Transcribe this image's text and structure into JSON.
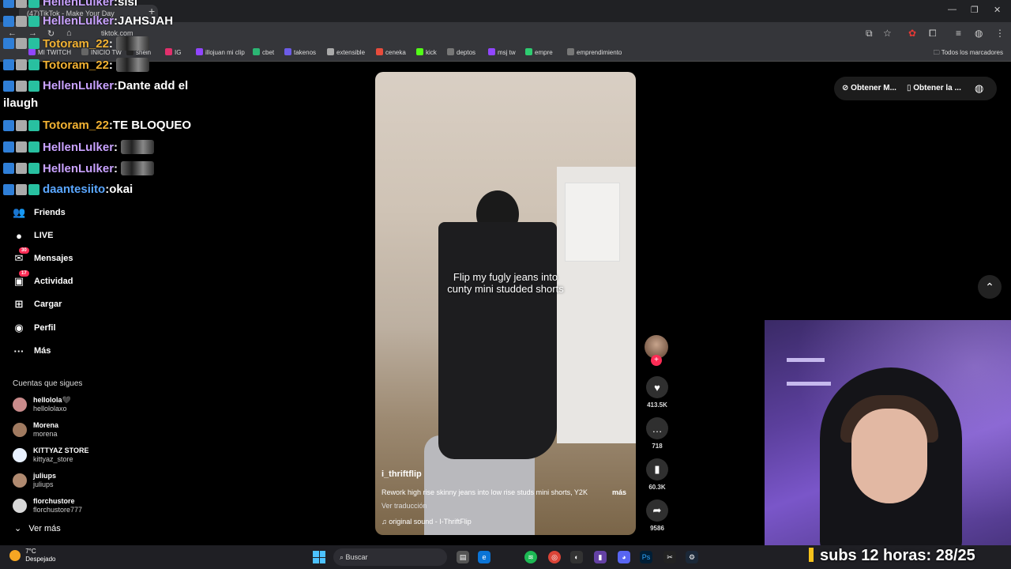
{
  "browser": {
    "tab_title": "(47)TikTok - Make Your Day",
    "url": "tiktok.com",
    "bookmarks": [
      {
        "label": "MI TWITCH",
        "color": "#9146ff"
      },
      {
        "label": "INICIO TW",
        "color": "#666666"
      },
      {
        "label": "shein",
        "color": "#222222"
      },
      {
        "label": "IG",
        "color": "#e1306c"
      },
      {
        "label": "illojuan mi clip",
        "color": "#9146ff"
      },
      {
        "label": "cbet",
        "color": "#2bb673"
      },
      {
        "label": "takenos",
        "color": "#6c5ce7"
      },
      {
        "label": "extensible",
        "color": "#aaaaaa"
      },
      {
        "label": "ceneka",
        "color": "#e74c3c"
      },
      {
        "label": "kick",
        "color": "#53fc18"
      },
      {
        "label": "deptos",
        "color": "#777777"
      },
      {
        "label": "msj tw",
        "color": "#9146ff"
      },
      {
        "label": "empre",
        "color": "#2ecc71"
      },
      {
        "label": "emprendimiento",
        "color": "#777777"
      }
    ],
    "all_bookmarks": "Todos los marcadores"
  },
  "chat": [
    {
      "user": "HellenLulker",
      "msg": "sisi",
      "color": "#c9a2ff",
      "emote": false
    },
    {
      "user": "HellenLulker",
      "msg": "JAHSJAH",
      "color": "#c9a2ff",
      "emote": false
    },
    {
      "user": "Totoram_22",
      "msg": "",
      "color": "#f2b233",
      "emote": true
    },
    {
      "user": "Totoram_22",
      "msg": "",
      "color": "#f2b233",
      "emote": true
    },
    {
      "user": "HellenLulker",
      "msg": "Dante add el",
      "color": "#c9a2ff",
      "emote": false
    },
    {
      "user": "",
      "msg": "ilaugh",
      "color": "#ffffff",
      "emote": false
    },
    {
      "user": "Totoram_22",
      "msg": "TE BLOQUEO",
      "color": "#f2b233",
      "emote": false
    },
    {
      "user": "HellenLulker",
      "msg": "",
      "color": "#c9a2ff",
      "emote": true
    },
    {
      "user": "HellenLulker",
      "msg": "",
      "color": "#c9a2ff",
      "emote": true
    },
    {
      "user": "daantesiito",
      "msg": "okai",
      "color": "#5aa7ff",
      "emote": false
    }
  ],
  "sidebar": {
    "nav": [
      {
        "label": "Friends",
        "icon": "friends-icon",
        "glyph": "👥",
        "badge": ""
      },
      {
        "label": "LIVE",
        "icon": "live-icon",
        "glyph": "●",
        "badge": ""
      },
      {
        "label": "Mensajes",
        "icon": "messages-icon",
        "glyph": "✉",
        "badge": "30"
      },
      {
        "label": "Actividad",
        "icon": "activity-icon",
        "glyph": "▣",
        "badge": "17"
      },
      {
        "label": "Cargar",
        "icon": "upload-icon",
        "glyph": "⊞",
        "badge": ""
      },
      {
        "label": "Perfil",
        "icon": "profile-icon",
        "glyph": "◉",
        "badge": ""
      },
      {
        "label": "Más",
        "icon": "more-icon",
        "glyph": "···",
        "badge": ""
      }
    ],
    "following_title": "Cuentas que sigues",
    "accounts": [
      {
        "name": "hellolola🖤",
        "handle": "hellololaxo",
        "color": "#c98b8b"
      },
      {
        "name": "Morena",
        "handle": "morena",
        "color": "#a07a60"
      },
      {
        "name": "KITTYAZ STORE",
        "handle": "kittyaz_store",
        "color": "#e8f1ff"
      },
      {
        "name": "juliups",
        "handle": "juliups",
        "color": "#b08a70"
      },
      {
        "name": "florchustore",
        "handle": "florchustore777",
        "color": "#d8d8d8"
      }
    ],
    "see_more": "Ver más"
  },
  "video": {
    "caption_line1": "Flip my fugly jeans into",
    "caption_line2": "cunty mini studded shorts",
    "username": "i_thriftflip",
    "description": "Rework high rise skinny jeans into low rise studs mini shorts, Y2K",
    "more": "más",
    "translate": "Ver traducción",
    "sound": "original sound - I-ThriftFlip"
  },
  "actions": {
    "likes": "413.5K",
    "comments": "718",
    "saves": "60.3K",
    "shares": "9586"
  },
  "top_right": {
    "btn1": "Obtener M...",
    "btn2": "Obtener la ..."
  },
  "taskbar": {
    "temp": "7°C",
    "condition": "Despejado",
    "search": "Buscar"
  },
  "overlay": {
    "subs": "subs 12 horas: 28/25"
  }
}
